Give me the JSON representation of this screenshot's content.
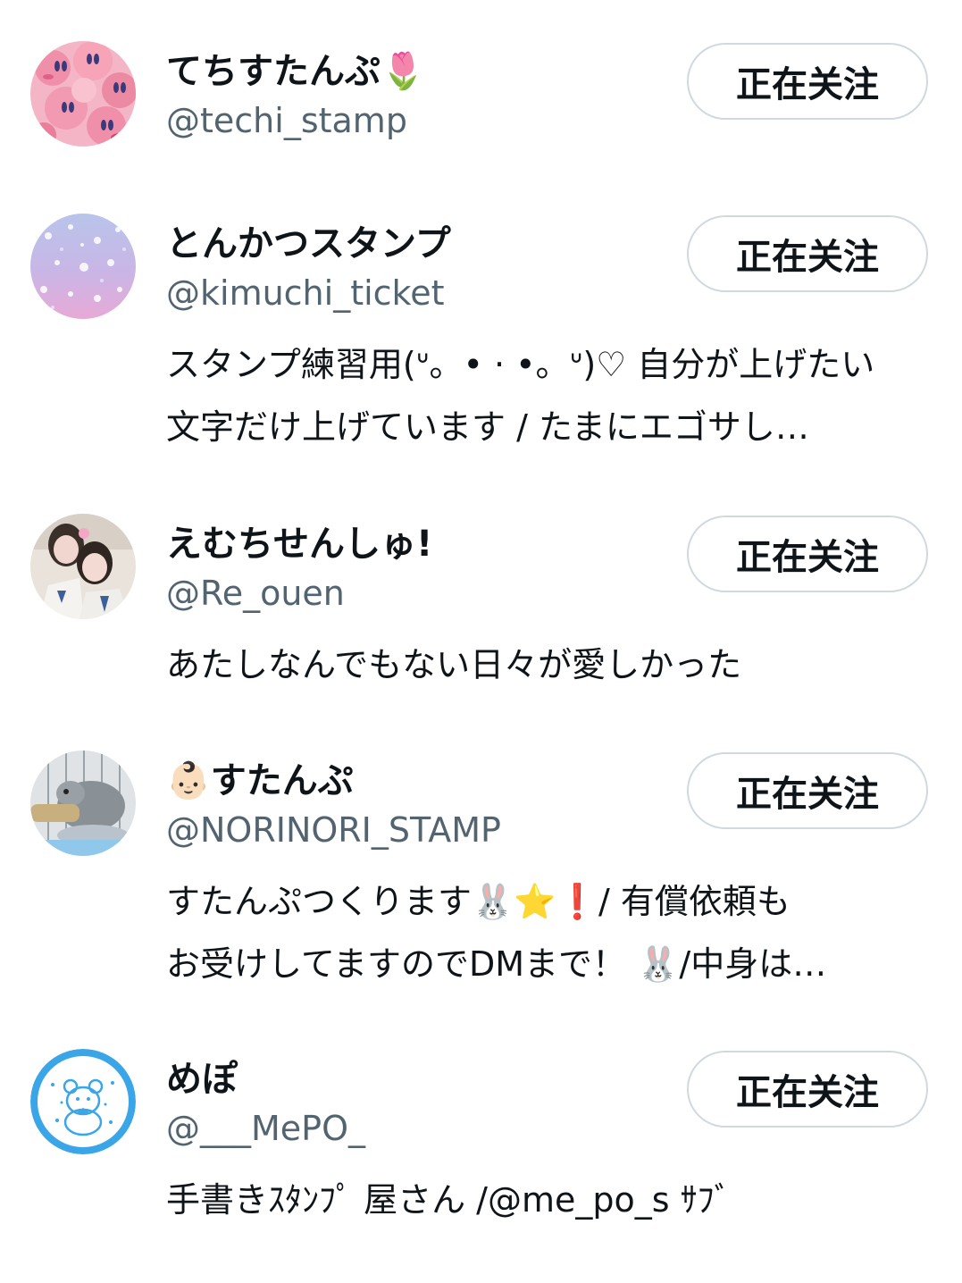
{
  "follow_button_label": "正在关注",
  "accounts": [
    {
      "name": "てちすたんぷ🌷",
      "handle": "@techi_stamp",
      "bio": "",
      "avatar_icon": "kirby-pattern-avatar"
    },
    {
      "name": "とんかつスタンプ",
      "handle": "@kimuchi_ticket",
      "bio": "スタンプ練習用(ᐡ。• · •。ᐡ)♡ 自分が上げたい\n文字だけ上げています / たまにエゴサし…",
      "avatar_icon": "star-pattern-avatar"
    },
    {
      "name": "えむちせんしゅ!",
      "handle": "@Re_ouen",
      "bio": "あたしなんでもない日々が愛しかった",
      "avatar_icon": "photo-avatar"
    },
    {
      "name": "👶🏻すたんぷ",
      "handle": "@NORINORI_STAMP",
      "bio": "すたんぷつくります🐰⭐❗/ 有償依頼も\nお受けしてますのでDMまで！ 🐰/中身は…",
      "avatar_icon": "chinchilla-avatar"
    },
    {
      "name": "めぽ",
      "handle": "@___MePO_",
      "bio": "手書きｽﾀﾝﾌﾟ 屋さん /@me_po_s ｻﾌﾞ",
      "avatar_icon": "bear-sketch-avatar"
    }
  ],
  "colors": {
    "text_primary": "#0f1419",
    "text_secondary": "#536471",
    "button_border": "#cfd9de"
  }
}
